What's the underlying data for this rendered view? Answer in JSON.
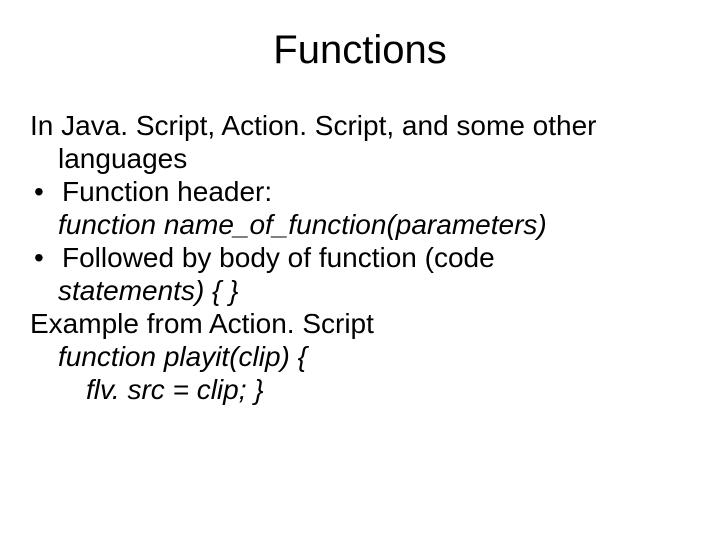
{
  "title": "Functions",
  "lines": {
    "l1": "In Java. Script, Action. Script, and some other",
    "l2": "languages",
    "bullet": "•",
    "l3": "Function header:",
    "l4": "function name_of_function(parameters)",
    "l5": "Followed by body of function (code",
    "l6": "statements)  {   }",
    "l7": "Example from Action. Script",
    "l8": "function playit(clip) {",
    "l9": "flv. src = clip;   }"
  }
}
